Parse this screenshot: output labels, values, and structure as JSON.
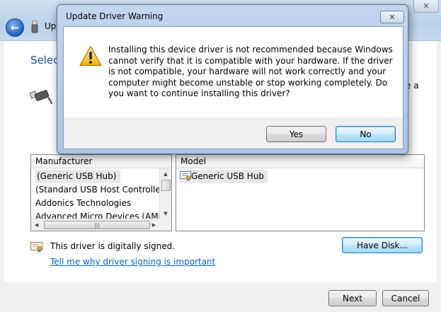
{
  "wizard": {
    "title": "Upd",
    "heading": "Selec",
    "trailing_text": "e a",
    "manufacturer_header": "Manufacturer",
    "manufacturers": [
      "(Generic USB Hub)",
      "(Standard USB Host Controller)",
      "Addonics Technologies",
      "Advanced Micro Devices (AMD)"
    ],
    "model_header": "Model",
    "models": [
      "Generic USB Hub"
    ],
    "signed_text": "This driver is digitally signed.",
    "signing_link": "Tell me why driver signing is important",
    "have_disk_label": "Have Disk...",
    "next_label": "Next",
    "cancel_label": "Cancel"
  },
  "dialog": {
    "title": "Update Driver Warning",
    "message": "Installing this device driver is not recommended because Windows cannot verify that it is compatible with your hardware.  If the driver is not compatible, your hardware will not work correctly and your computer might become unstable or stop working completely.  Do you want to continue installing this driver?",
    "yes_label": "Yes",
    "no_label": "No"
  },
  "icons": {
    "back": "back-arrow-icon",
    "warning": "warning-icon",
    "certificate": "certificate-icon",
    "usb": "usb-icon",
    "close": "close-icon"
  },
  "colors": {
    "heading": "#1e4f9c",
    "link": "#0066cc",
    "focus_button": "#bee6fd"
  }
}
